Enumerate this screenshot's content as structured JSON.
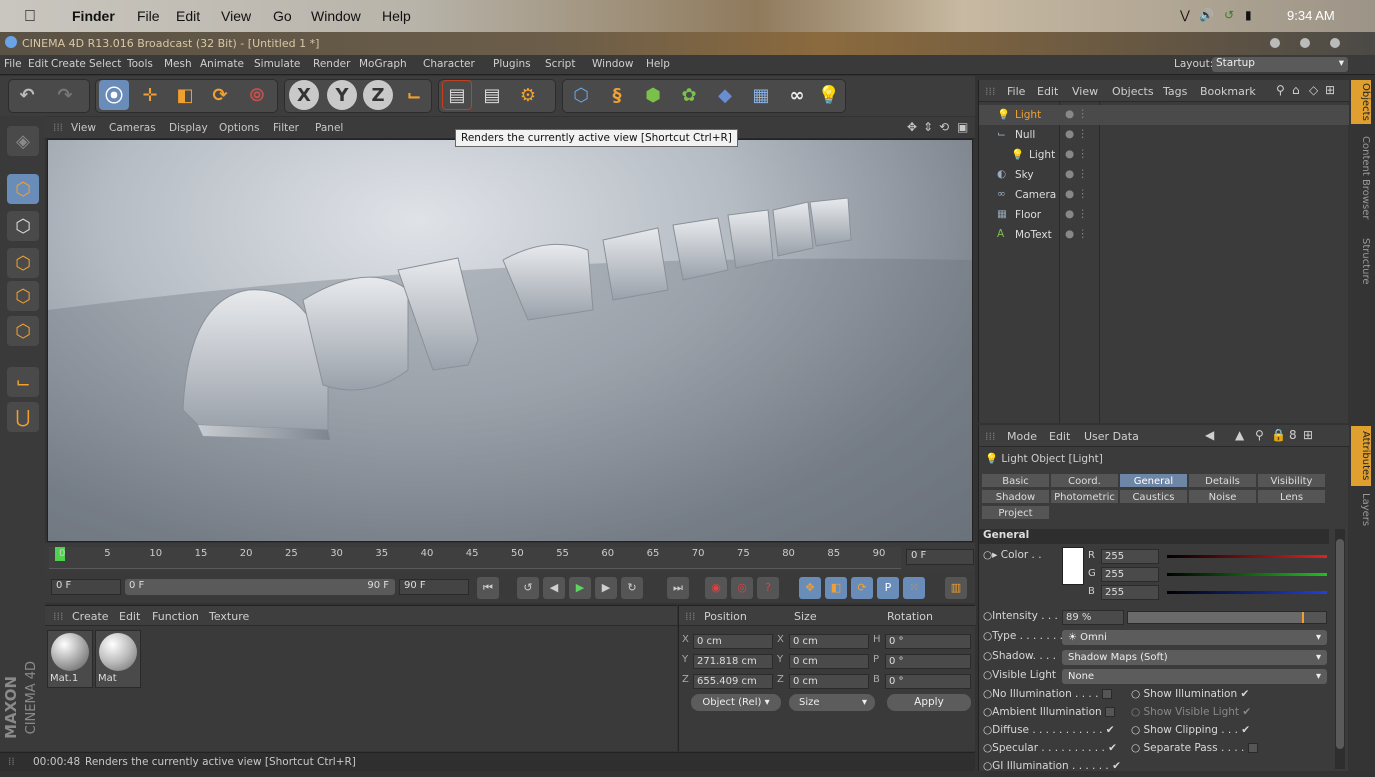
{
  "mac_menubar": {
    "apple": "",
    "app": "Finder",
    "items": [
      "File",
      "Edit",
      "View",
      "Go",
      "Window",
      "Help"
    ],
    "clock": "9:34 AM"
  },
  "window_title": "CINEMA 4D R13.016 Broadcast (32 Bit) - [Untitled 1 *]",
  "app_menu": [
    "File",
    "Edit",
    "Create",
    "Select",
    "Tools",
    "Mesh",
    "Animate",
    "Simulate",
    "Render",
    "MoGraph",
    "Character",
    "Plugins",
    "Script",
    "Window",
    "Help"
  ],
  "layout": {
    "label": "Layout:",
    "value": "Startup"
  },
  "viewport_menu": [
    "View",
    "Cameras",
    "Display",
    "Options",
    "Filter",
    "Panel"
  ],
  "tooltip": "Renders the currently active view [Shortcut Ctrl+R]",
  "timeline": {
    "ticks": [
      "0",
      "5",
      "10",
      "15",
      "20",
      "25",
      "30",
      "35",
      "40",
      "45",
      "50",
      "55",
      "60",
      "65",
      "70",
      "75",
      "80",
      "85",
      "90"
    ],
    "current": "0 F"
  },
  "transport": {
    "start": "0 F",
    "range_start": "0 F",
    "range_end": "90 F",
    "end": "90 F"
  },
  "materials": {
    "menu": [
      "Create",
      "Edit",
      "Function",
      "Texture"
    ],
    "items": [
      "Mat.1",
      "Mat"
    ]
  },
  "coords": {
    "headers": [
      "Position",
      "Size",
      "Rotation"
    ],
    "rows": [
      {
        "a": "X",
        "pos": "0 cm",
        "b": "X",
        "size": "0 cm",
        "c": "H",
        "rot": "0 °"
      },
      {
        "a": "Y",
        "pos": "271.818 cm",
        "b": "Y",
        "size": "0 cm",
        "c": "P",
        "rot": "0 °"
      },
      {
        "a": "Z",
        "pos": "655.409 cm",
        "b": "Z",
        "size": "0 cm",
        "c": "B",
        "rot": "0 °"
      }
    ],
    "mode": "Object (Rel)",
    "size_mode": "Size",
    "apply": "Apply"
  },
  "brand": {
    "line1": "MAXON",
    "line2": "CINEMA 4D"
  },
  "status": {
    "time": "00:00:48",
    "text": "Renders the currently active view [Shortcut Ctrl+R]"
  },
  "objects": {
    "menu": [
      "File",
      "Edit",
      "View",
      "Objects",
      "Tags",
      "Bookmark"
    ],
    "items": [
      {
        "name": "Light",
        "indent": 0,
        "selected": true
      },
      {
        "name": "Null",
        "indent": 0,
        "selected": false
      },
      {
        "name": "Light",
        "indent": 1,
        "selected": false
      },
      {
        "name": "Sky",
        "indent": 0,
        "selected": false
      },
      {
        "name": "Camera",
        "indent": 0,
        "selected": false
      },
      {
        "name": "Floor",
        "indent": 0,
        "selected": false
      },
      {
        "name": "MoText",
        "indent": 0,
        "selected": false
      }
    ]
  },
  "attributes": {
    "menu": [
      "Mode",
      "Edit",
      "User Data"
    ],
    "title": "Light Object [Light]",
    "tabs_row1": [
      "Basic",
      "Coord.",
      "General",
      "Details",
      "Visibility"
    ],
    "tabs_row2": [
      "Shadow",
      "Photometric",
      "Caustics",
      "Noise",
      "Lens"
    ],
    "tabs_row3": [
      "Project"
    ],
    "active_tab": "General",
    "section": "General",
    "color_label": "Color . .",
    "r": "255",
    "g": "255",
    "b": "255",
    "intensity_label": "Intensity . . .",
    "intensity": "89 %",
    "intensity_level": 0.89,
    "type_label": "Type . . . . . . .",
    "type": "Omni",
    "shadow_label": "Shadow. . . .",
    "shadow": "Shadow Maps (Soft)",
    "visible_label": "Visible Light",
    "visible": "None",
    "checks_left": [
      "No Illumination . . . .",
      "Ambient Illumination",
      "Diffuse . . . . . . . . . . .",
      "Specular . . . . . . . . . .",
      "GI Illumination . . . . . ."
    ],
    "checks_right": [
      "Show Illumination",
      "Show Visible Light",
      "Show Clipping . . .",
      "Separate Pass . . . ."
    ]
  },
  "side_tabs": [
    "Objects",
    "Content Browser",
    "Structure",
    "Attributes",
    "Layers"
  ]
}
